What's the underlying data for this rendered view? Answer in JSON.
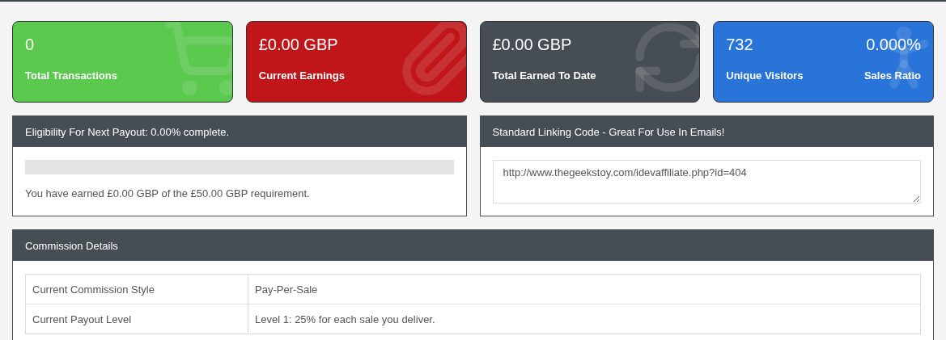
{
  "stat_cards": [
    {
      "kind": "cart",
      "color": "#5bc84e",
      "stats": [
        {
          "value": "0",
          "label": "Total Transactions"
        }
      ]
    },
    {
      "kind": "clip",
      "color": "#c0161a",
      "stats": [
        {
          "value": "£0.00 GBP",
          "label": "Current Earnings"
        }
      ]
    },
    {
      "kind": "refresh",
      "color": "#474d54",
      "stats": [
        {
          "value": "£0.00 GBP",
          "label": "Total Earned To Date"
        }
      ]
    },
    {
      "kind": "person",
      "color": "#2874d8",
      "stats": [
        {
          "value": "732",
          "label": "Unique Visitors"
        },
        {
          "value": "0.000%",
          "label": "Sales Ratio"
        }
      ]
    }
  ],
  "payout_panel": {
    "title": "Eligibility For Next Payout: 0.00% complete.",
    "progress": {
      "level": 0
    },
    "text": "You have earned £0.00 GBP of the £50.00 GBP requirement."
  },
  "linking_panel": {
    "title": "Standard Linking Code - Great For Use In Emails!",
    "code": "http://www.thegeekstoy.com/idevaffiliate.php?id=404"
  },
  "commission_panel": {
    "title": "Commission Details",
    "rows": [
      {
        "label": "Current Commission Style",
        "value": "Pay-Per-Sale"
      },
      {
        "label": "Current Payout Level",
        "value": "Level 1: 25% for each sale you deliver."
      }
    ]
  }
}
